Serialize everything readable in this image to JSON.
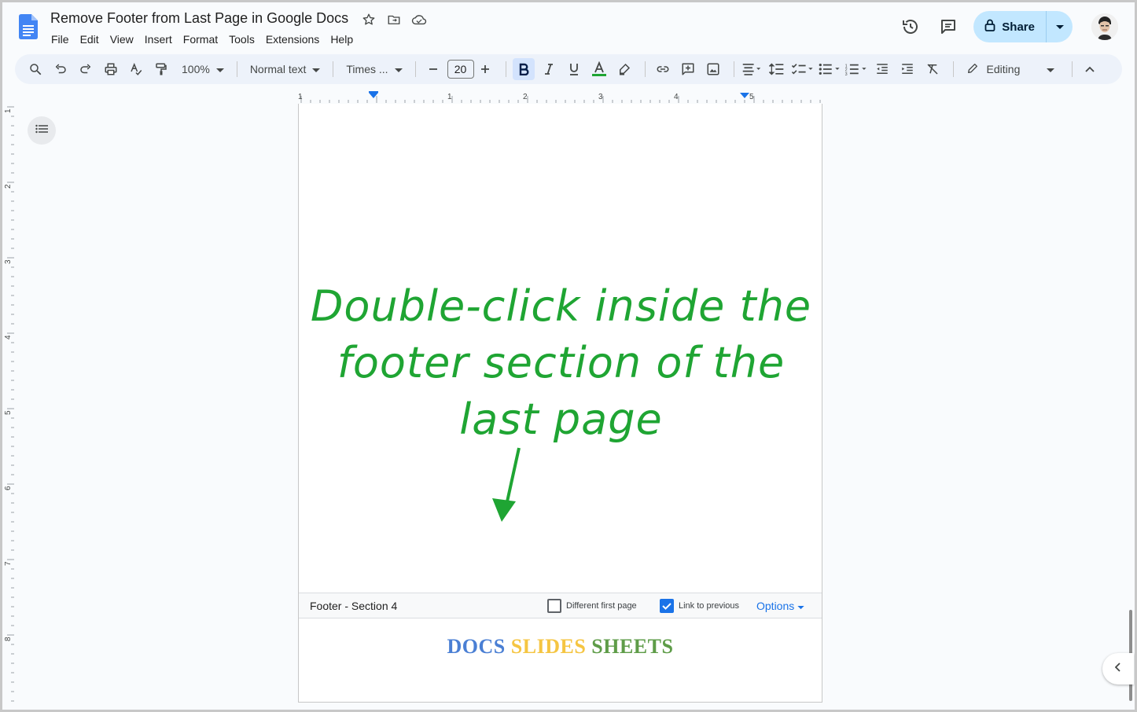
{
  "document": {
    "title": "Remove Footer from Last Page in Google Docs"
  },
  "menu": [
    "File",
    "Edit",
    "View",
    "Insert",
    "Format",
    "Tools",
    "Extensions",
    "Help"
  ],
  "share": {
    "label": "Share"
  },
  "toolbar": {
    "zoom": "100%",
    "style": "Normal text",
    "font": "Times ...",
    "font_size": "20",
    "mode": "Editing",
    "icons": [
      "search-icon",
      "undo-icon",
      "redo-icon",
      "print-icon",
      "spellcheck-icon",
      "paint-format-icon",
      "bold-icon",
      "italic-icon",
      "underline-icon",
      "text-color-icon",
      "highlight-icon",
      "link-icon",
      "comment-icon",
      "image-icon",
      "align-icon",
      "line-spacing-icon",
      "checklist-icon",
      "bullet-list-icon",
      "numbered-list-icon",
      "decrease-indent-icon",
      "increase-indent-icon",
      "clear-formatting-icon",
      "pencil-icon",
      "collapse-icon"
    ]
  },
  "ruler": {
    "h_labels": [
      "1",
      "1",
      "2",
      "3",
      "4",
      "5"
    ],
    "v_labels": [
      "1",
      "2",
      "3",
      "4",
      "5",
      "6",
      "7",
      "8"
    ]
  },
  "annotation": {
    "line1": "Double-click inside the",
    "line2": "footer section of the",
    "line3": "last page",
    "color": "#1fa533"
  },
  "footer": {
    "label": "Footer - Section 4",
    "different_first_page": "Different first page",
    "different_first_page_checked": false,
    "link_to_previous": "Link to previous",
    "link_to_previous_checked": true,
    "options": "Options",
    "text_docs": "DOCS",
    "text_slides": "SLIDES",
    "text_sheets": "SHEETS"
  },
  "colors": {
    "accent": "#1a73e8",
    "share_bg": "#c2e7ff",
    "docs": "#4a7fd4",
    "slides": "#f5c542",
    "sheets": "#5e9c48"
  }
}
